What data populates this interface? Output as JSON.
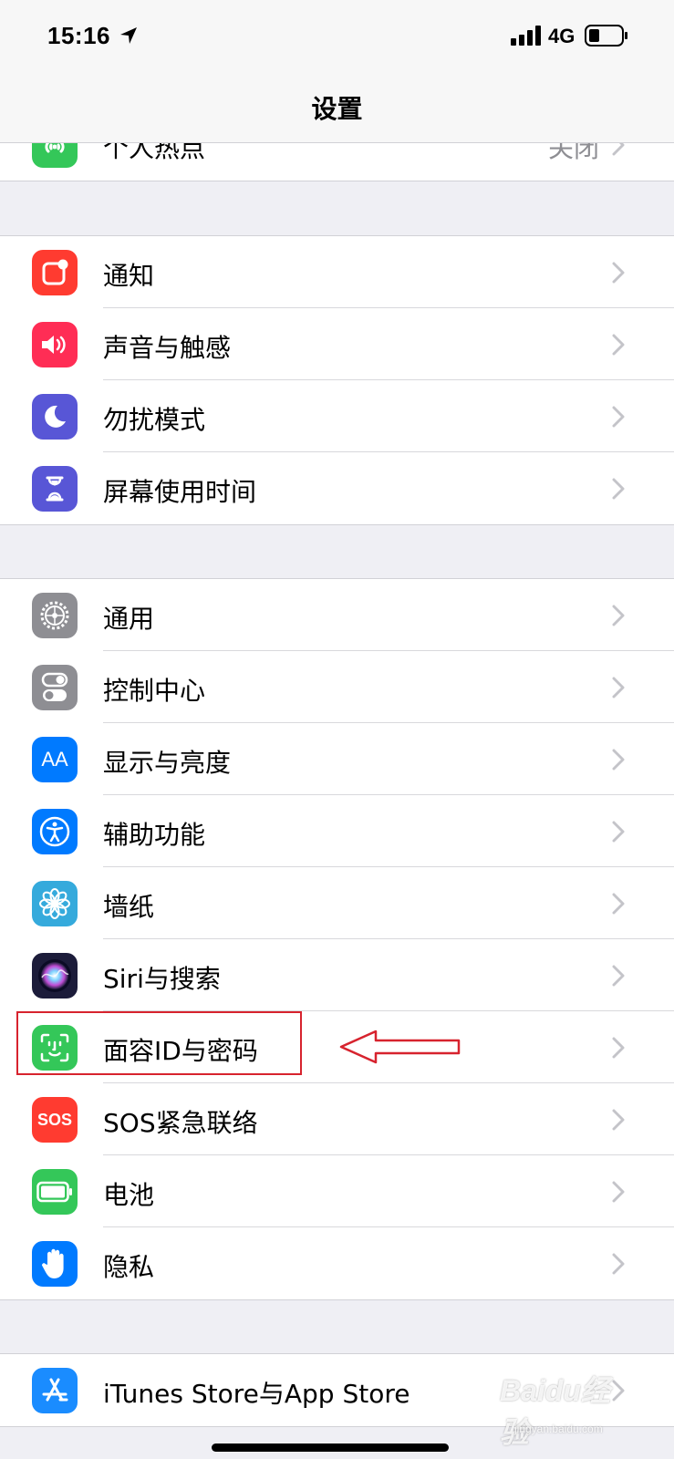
{
  "status_bar": {
    "time": "15:16",
    "network": "4G"
  },
  "nav": {
    "title": "设置"
  },
  "groups": [
    {
      "id": "top",
      "items": [
        {
          "key": "hotspot",
          "label": "个人热点",
          "value": "关闭",
          "icon": "hotspot-icon",
          "color": "#34c759"
        }
      ]
    },
    {
      "id": "notify",
      "items": [
        {
          "key": "notifications",
          "label": "通知",
          "icon": "notifications-icon",
          "color": "#ff3b30"
        },
        {
          "key": "sounds",
          "label": "声音与触感",
          "icon": "speaker-icon",
          "color": "#ff2d55"
        },
        {
          "key": "dnd",
          "label": "勿扰模式",
          "icon": "moon-icon",
          "color": "#5856d6"
        },
        {
          "key": "screentime",
          "label": "屏幕使用时间",
          "icon": "hourglass-icon",
          "color": "#5856d6"
        }
      ]
    },
    {
      "id": "general",
      "items": [
        {
          "key": "general",
          "label": "通用",
          "icon": "gear-icon",
          "color": "#8e8e93"
        },
        {
          "key": "control",
          "label": "控制中心",
          "icon": "toggles-icon",
          "color": "#8e8e93"
        },
        {
          "key": "display",
          "label": "显示与亮度",
          "icon": "text-size-icon",
          "color": "#007aff",
          "icon_text": "AA"
        },
        {
          "key": "accessibility",
          "label": "辅助功能",
          "icon": "accessibility-icon",
          "color": "#007aff"
        },
        {
          "key": "wallpaper",
          "label": "墙纸",
          "icon": "flower-icon",
          "color": "#35aadc"
        },
        {
          "key": "siri",
          "label": "Siri与搜索",
          "icon": "siri-icon",
          "color": "#1c1c3a"
        },
        {
          "key": "faceid",
          "label": "面容ID与密码",
          "icon": "face-id-icon",
          "color": "#34c759"
        },
        {
          "key": "sos",
          "label": "SOS紧急联络",
          "icon": "sos-icon",
          "color": "#ff3b30",
          "icon_text": "SOS"
        },
        {
          "key": "battery",
          "label": "电池",
          "icon": "battery-icon",
          "color": "#34c759"
        },
        {
          "key": "privacy",
          "label": "隐私",
          "icon": "hand-icon",
          "color": "#007aff"
        }
      ]
    },
    {
      "id": "store",
      "items": [
        {
          "key": "appstore",
          "label": "iTunes Store与App Store",
          "icon": "app-store-icon",
          "color": "#1a8cff"
        }
      ]
    }
  ],
  "watermark": {
    "text": "Baidu经验",
    "sub": "jingyan.baidu.com"
  }
}
